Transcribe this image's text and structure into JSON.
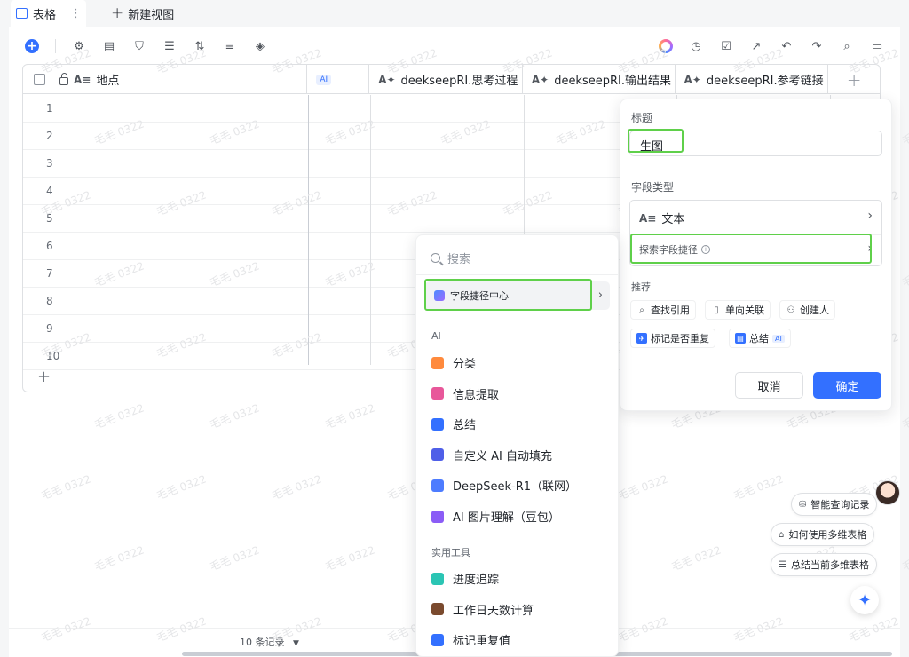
{
  "tabs": {
    "active_label": "表格",
    "new_view_label": "新建视图"
  },
  "toolbar": {
    "left_icons": [
      "add-icon",
      "gear-icon",
      "field-settings-icon",
      "filter-icon",
      "group-icon",
      "sort-icon",
      "row-height-icon",
      "fill-color-icon"
    ],
    "right_icons": [
      "ai-ring-icon",
      "history-icon",
      "checklist-icon",
      "share-icon",
      "undo-icon",
      "redo-icon",
      "search-icon",
      "comment-icon"
    ]
  },
  "table": {
    "columns": [
      {
        "label": "地点",
        "type": "text"
      },
      {
        "label": "AI",
        "type": "ai"
      },
      {
        "label": "deekseepRI.思考过程",
        "type": "ai-text"
      },
      {
        "label": "deekseepRI.输出结果",
        "type": "ai-text"
      },
      {
        "label": "deekseepRI.参考链接",
        "type": "ai-text"
      }
    ],
    "row_numbers": [
      "1",
      "2",
      "3",
      "4",
      "5",
      "6",
      "7",
      "8",
      "9",
      "10"
    ],
    "records_label": "10 条记录"
  },
  "field_panel": {
    "title_label": "标题",
    "title_value": "生图",
    "type_label": "字段类型",
    "type_value": "文本",
    "explore_label": "探索字段捷径",
    "recommend_label": "推荐",
    "chips": [
      {
        "label": "查找引用",
        "icon": "lookup-icon"
      },
      {
        "label": "单向关联",
        "icon": "link-icon"
      },
      {
        "label": "创建人",
        "icon": "person-icon"
      },
      {
        "label": "标记是否重复",
        "icon": "pin-icon"
      },
      {
        "label": "总结",
        "icon": "summary-icon",
        "badge": "AI"
      }
    ],
    "cancel_label": "取消",
    "confirm_label": "确定"
  },
  "dropdown": {
    "search_placeholder": "搜索",
    "center_label": "字段捷径中心",
    "ai_section": "AI",
    "ai_items": [
      {
        "label": "分类",
        "color": "#ff8a3d"
      },
      {
        "label": "信息提取",
        "color": "#e8579a"
      },
      {
        "label": "总结",
        "color": "#3370ff"
      },
      {
        "label": "自定义 AI 自动填充",
        "color": "#4f5fe8"
      },
      {
        "label": "DeepSeek-R1（联网）",
        "color": "#4d7cff"
      },
      {
        "label": "AI 图片理解（豆包）",
        "color": "#8b5cf6"
      }
    ],
    "tools_section": "实用工具",
    "tool_items": [
      {
        "label": "进度追踪",
        "color": "#2bc5b4"
      },
      {
        "label": "工作日天数计算",
        "color": "#7a4a2e"
      },
      {
        "label": "标记重复值",
        "color": "#3370ff"
      }
    ]
  },
  "assistant": {
    "pills": [
      "智能查询记录",
      "如何使用多维表格",
      "总结当前多维表格"
    ]
  },
  "watermark_text": "毛毛 0322"
}
